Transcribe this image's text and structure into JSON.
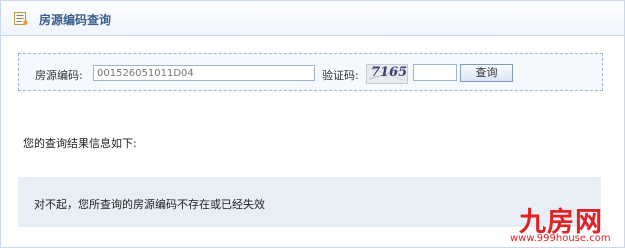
{
  "header": {
    "icon": "document-list-icon",
    "title": "房源编码查询"
  },
  "search": {
    "house_code_label": "房源编码:",
    "house_code_value": "001526051011D04",
    "captcha_label": "验证码:",
    "captcha_text": "7165",
    "captcha_input_value": "",
    "query_button_label": "查询"
  },
  "result": {
    "intro": "您的查询结果信息如下:",
    "message": "对不起，您所查询的房源编码不存在或已经失效"
  },
  "watermark": {
    "logo": "九房网",
    "url": "www.999house.com"
  },
  "colors": {
    "title": "#3a5f8e",
    "border": "#c9d9ea",
    "result_bg": "#e8eef6",
    "watermark": "#e02222"
  }
}
